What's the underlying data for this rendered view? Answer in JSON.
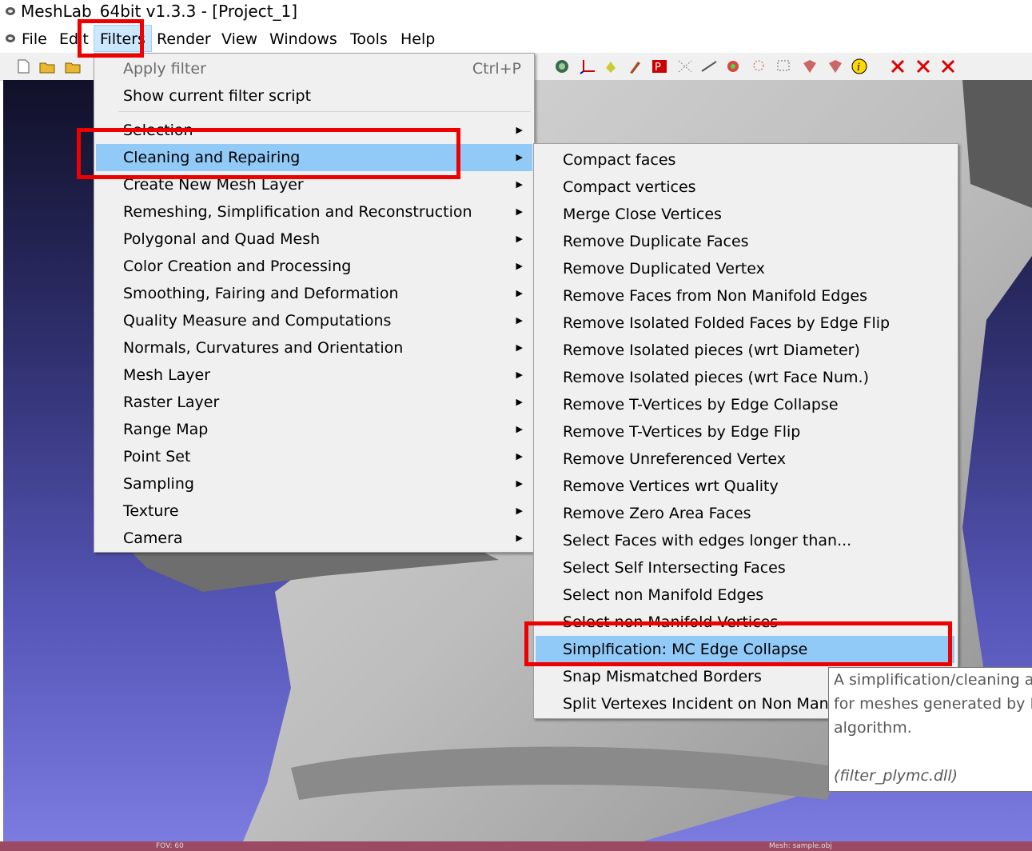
{
  "window": {
    "title": "MeshLab_64bit v1.3.3 - [Project_1]"
  },
  "menubar": {
    "items": [
      {
        "label": "File"
      },
      {
        "label": "Edit"
      },
      {
        "label": "Filters"
      },
      {
        "label": "Render"
      },
      {
        "label": "View"
      },
      {
        "label": "Windows"
      },
      {
        "label": "Tools"
      },
      {
        "label": "Help"
      }
    ]
  },
  "filters_menu": {
    "apply_filter": {
      "label": "Apply filter",
      "shortcut": "Ctrl+P"
    },
    "show_script": {
      "label": "Show current filter script"
    },
    "categories": [
      "Selection",
      "Cleaning and Repairing",
      "Create New Mesh Layer",
      "Remeshing, Simplification and Reconstruction",
      "Polygonal and Quad Mesh",
      "Color Creation and Processing",
      "Smoothing, Fairing and Deformation",
      "Quality Measure and Computations",
      "Normals, Curvatures and Orientation",
      "Mesh Layer",
      "Raster Layer",
      "Range Map",
      "Point Set",
      "Sampling",
      "Texture",
      "Camera"
    ],
    "arrow": "▶"
  },
  "cleaning_submenu": {
    "items": [
      "Compact faces",
      "Compact vertices",
      "Merge Close Vertices",
      "Remove Duplicate Faces",
      "Remove Duplicated Vertex",
      "Remove Faces from Non Manifold Edges",
      "Remove Isolated Folded Faces by Edge Flip",
      "Remove Isolated pieces (wrt Diameter)",
      "Remove Isolated pieces (wrt Face Num.)",
      "Remove T-Vertices by Edge Collapse",
      "Remove T-Vertices by Edge Flip",
      "Remove Unreferenced Vertex",
      "Remove Vertices wrt Quality",
      "Remove Zero Area Faces",
      "Select Faces with edges longer than...",
      "Select Self Intersecting Faces",
      "Select non Manifold Edges",
      "Select non Manifold Vertices",
      "Simplfication: MC Edge Collapse",
      "Snap Mismatched Borders",
      "Split Vertexes Incident on Non Manifold Faces"
    ]
  },
  "tooltip": {
    "lines": [
      "A simplification/cleaning algorithm that works ok",
      "for meshes generated by Marching Cubes",
      "algorithm."
    ],
    "source": "(filter_plymc.dll)"
  },
  "statusbar": {
    "fov": "FOV: 60",
    "mesh": "Mesh: sample.obj"
  },
  "colors": {
    "menu_bg": "#f0f0f0",
    "highlight": "#91c9f7",
    "annotation": "#ee0000"
  }
}
